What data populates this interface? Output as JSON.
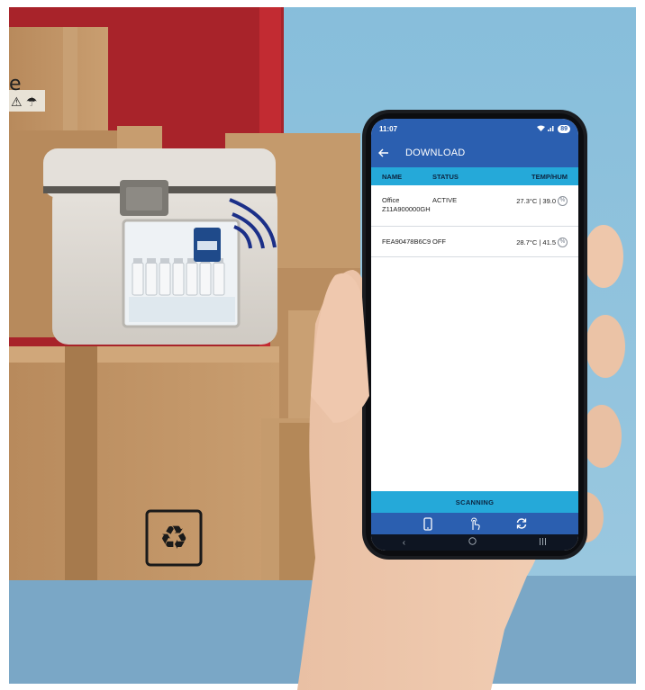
{
  "phone": {
    "status_time": "11:07",
    "battery": "89",
    "app_title": "DOWNLOAD",
    "columns": {
      "name": "NAME",
      "status": "STATUS",
      "temp": "TEMP/HUM"
    },
    "rows": [
      {
        "name_line1": "Office",
        "name_line2": "Z11A900000GH",
        "status": "ACTIVE",
        "temp": "27.3°C | 39.0"
      },
      {
        "name_line1": "FEA90478B6C9",
        "name_line2": "",
        "status": "OFF",
        "temp": "28.7°C | 41.5"
      }
    ],
    "scan_label": "SCANNING",
    "icons": [
      "back-arrow-icon",
      "phone-icon",
      "touch-icon",
      "sync-icon",
      "nav-back-icon",
      "nav-home-icon",
      "nav-recents-icon"
    ]
  },
  "colors": {
    "app_blue": "#2b5fb0",
    "header_cyan": "#25a9d9",
    "wall_blue": "#7fb4d4",
    "door_red": "#b3232a"
  }
}
